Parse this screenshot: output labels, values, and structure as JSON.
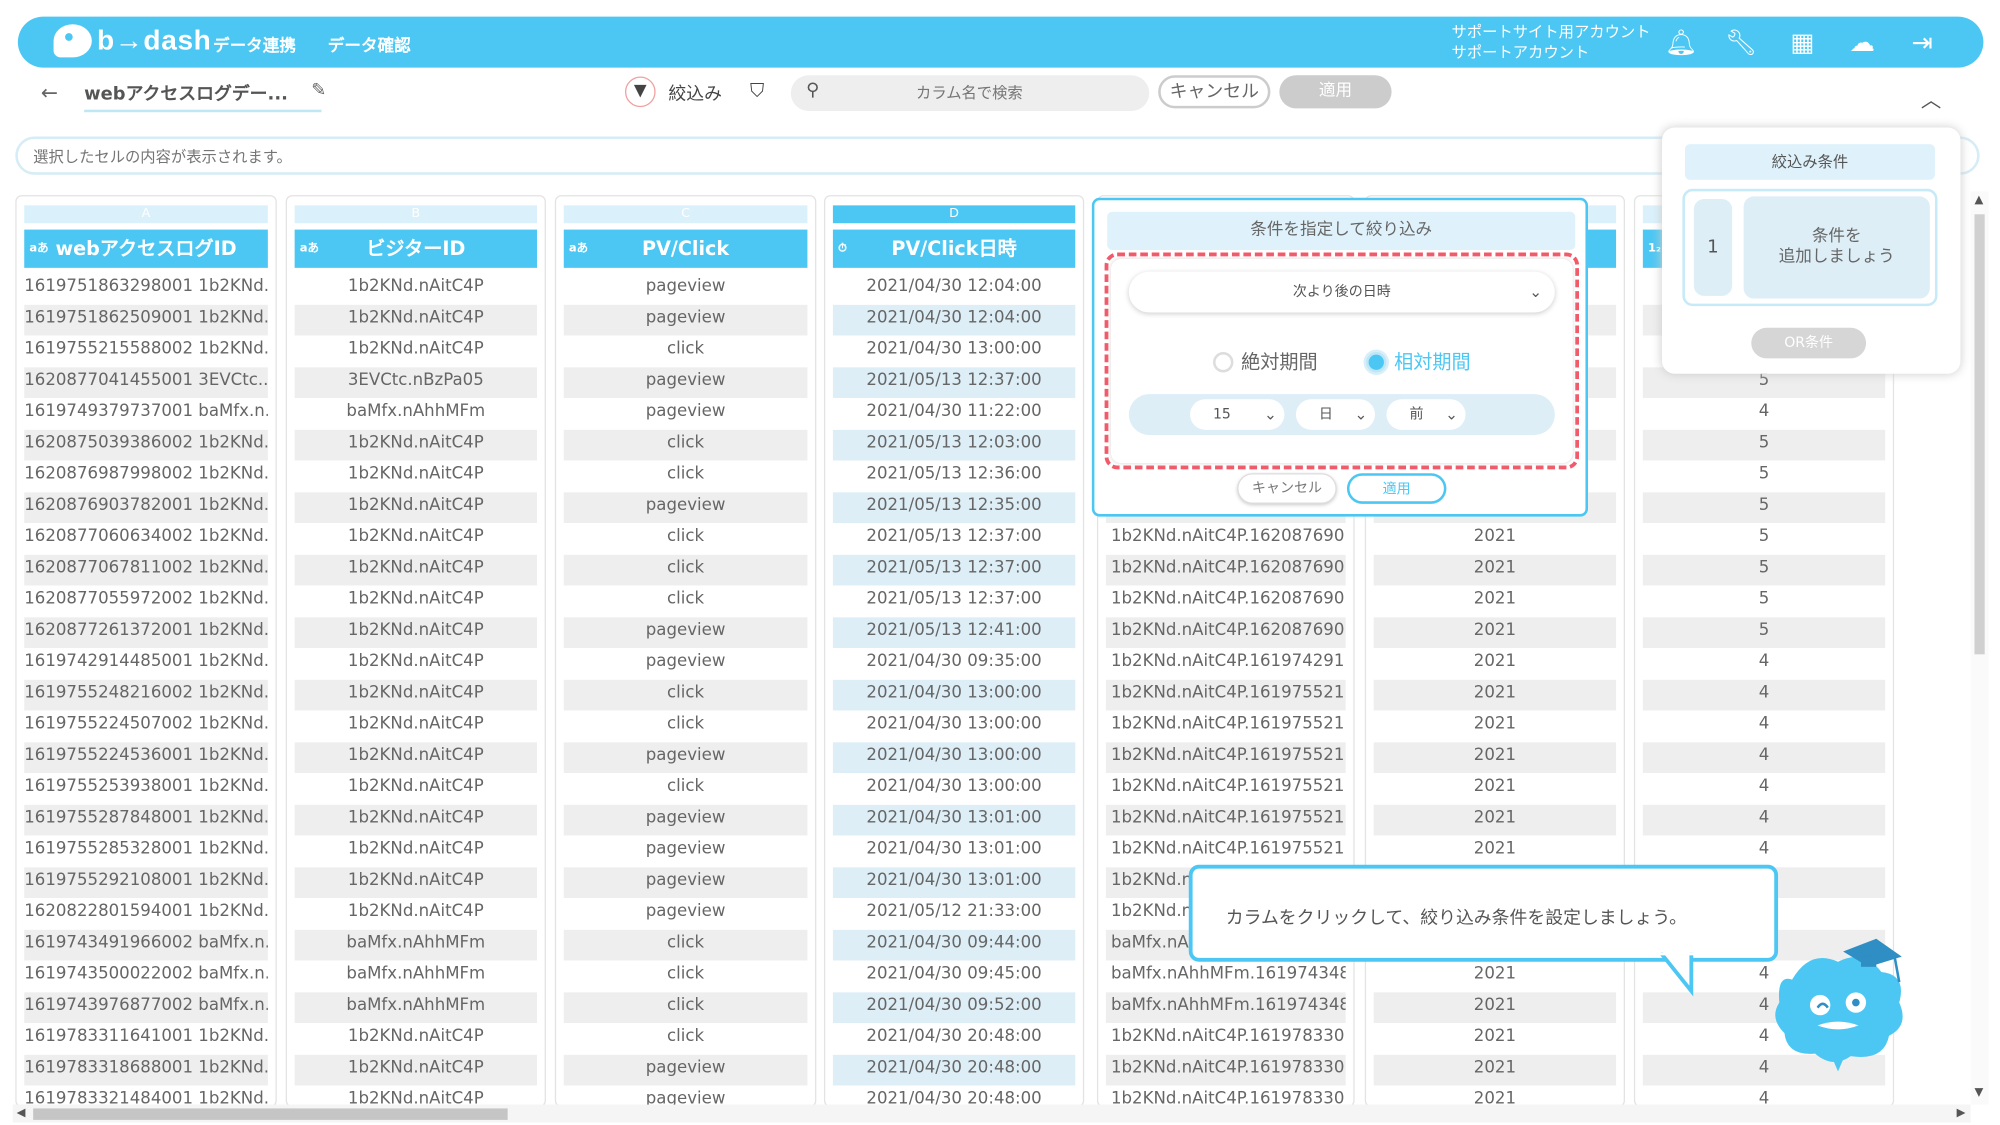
{
  "header": {
    "logo_text": "b→dash",
    "nav": [
      "データ連携",
      "データ確認"
    ],
    "account_line1": "サポートサイト用アカウント",
    "account_line2": "サポートアカウント",
    "icons": [
      "bell-icon",
      "wrench-icon",
      "grid-icon",
      "mascot-icon",
      "logout-icon"
    ]
  },
  "toolbar": {
    "back_icon": "←",
    "dataset_name": "webアクセスログデー...",
    "filter_label": "絞込み",
    "search_placeholder": "カラム名で検索",
    "cancel_label": "キャンセル",
    "apply_label": "適用"
  },
  "cell_preview": {
    "placeholder": "選択したセルの内容が表示されます。"
  },
  "columns": [
    {
      "letter": "A",
      "type_icon": "aあ",
      "name": "webアクセスログID"
    },
    {
      "letter": "B",
      "type_icon": "aあ",
      "name": "ビジターID"
    },
    {
      "letter": "C",
      "type_icon": "aあ",
      "name": "PV/Click"
    },
    {
      "letter": "D",
      "type_icon": "⏱",
      "name": "PV/Click日時"
    },
    {
      "letter": "",
      "type_icon": "",
      "name": ""
    },
    {
      "letter": "",
      "type_icon": "",
      "name": ""
    },
    {
      "letter": "",
      "type_icon": "1₂",
      "name": ""
    }
  ],
  "rows": [
    [
      "1619751863298001 1b2KNd...",
      "1b2KNd.nAitC4P",
      "pageview",
      "2021/04/30 12:04:00",
      "",
      "",
      ""
    ],
    [
      "1619751862509001 1b2KNd...",
      "1b2KNd.nAitC4P",
      "pageview",
      "2021/04/30 12:04:00",
      "",
      "",
      ""
    ],
    [
      "1619755215588002 1b2KNd...",
      "1b2KNd.nAitC4P",
      "click",
      "2021/04/30 13:00:00",
      "",
      "",
      ""
    ],
    [
      "1620877041455001 3EVCtc....",
      "3EVCtc.nBzPa05",
      "pageview",
      "2021/05/13 12:37:00",
      "",
      "",
      "5"
    ],
    [
      "1619749379737001 baMfx.n...",
      "baMfx.nAhhMFm",
      "pageview",
      "2021/04/30 11:22:00",
      "",
      "",
      "4"
    ],
    [
      "1620875039386002 1b2KNd...",
      "1b2KNd.nAitC4P",
      "click",
      "2021/05/13 12:03:00",
      "",
      "",
      "5"
    ],
    [
      "1620876987998002 1b2KNd...",
      "1b2KNd.nAitC4P",
      "click",
      "2021/05/13 12:36:00",
      "",
      "",
      "5"
    ],
    [
      "1620876903782001 1b2KNd...",
      "1b2KNd.nAitC4P",
      "pageview",
      "2021/05/13 12:35:00",
      "",
      "",
      "5"
    ],
    [
      "1620877060634002 1b2KNd...",
      "1b2KNd.nAitC4P",
      "click",
      "2021/05/13 12:37:00",
      "1b2KNd.nAitC4P.162087690...",
      "2021",
      "5"
    ],
    [
      "1620877067811002 1b2KNd...",
      "1b2KNd.nAitC4P",
      "click",
      "2021/05/13 12:37:00",
      "1b2KNd.nAitC4P.162087690...",
      "2021",
      "5"
    ],
    [
      "1620877055972002 1b2KNd...",
      "1b2KNd.nAitC4P",
      "click",
      "2021/05/13 12:37:00",
      "1b2KNd.nAitC4P.162087690...",
      "2021",
      "5"
    ],
    [
      "1620877261372001 1b2KNd...",
      "1b2KNd.nAitC4P",
      "pageview",
      "2021/05/13 12:41:00",
      "1b2KNd.nAitC4P.162087690...",
      "2021",
      "5"
    ],
    [
      "1619742914485001 1b2KNd...",
      "1b2KNd.nAitC4P",
      "pageview",
      "2021/04/30 09:35:00",
      "1b2KNd.nAitC4P.161974291...",
      "2021",
      "4"
    ],
    [
      "1619755248216002 1b2KNd...",
      "1b2KNd.nAitC4P",
      "click",
      "2021/04/30 13:00:00",
      "1b2KNd.nAitC4P.161975521...",
      "2021",
      "4"
    ],
    [
      "1619755224507002 1b2KNd...",
      "1b2KNd.nAitC4P",
      "click",
      "2021/04/30 13:00:00",
      "1b2KNd.nAitC4P.161975521...",
      "2021",
      "4"
    ],
    [
      "1619755224536001 1b2KNd...",
      "1b2KNd.nAitC4P",
      "pageview",
      "2021/04/30 13:00:00",
      "1b2KNd.nAitC4P.161975521...",
      "2021",
      "4"
    ],
    [
      "1619755253938001 1b2KNd...",
      "1b2KNd.nAitC4P",
      "click",
      "2021/04/30 13:00:00",
      "1b2KNd.nAitC4P.161975521...",
      "2021",
      "4"
    ],
    [
      "1619755287848001 1b2KNd...",
      "1b2KNd.nAitC4P",
      "pageview",
      "2021/04/30 13:01:00",
      "1b2KNd.nAitC4P.161975521...",
      "2021",
      "4"
    ],
    [
      "1619755285328001 1b2KNd...",
      "1b2KNd.nAitC4P",
      "pageview",
      "2021/04/30 13:01:00",
      "1b2KNd.nAitC4P.161975521...",
      "2021",
      "4"
    ],
    [
      "1619755292108001 1b2KNd...",
      "1b2KNd.nAitC4P",
      "pageview",
      "2021/04/30 13:01:00",
      "1b2KNd.n",
      "",
      ""
    ],
    [
      "1620822801594001 1b2KNd...",
      "1b2KNd.nAitC4P",
      "pageview",
      "2021/05/12 21:33:00",
      "1b2KNd.n",
      "",
      ""
    ],
    [
      "1619743491966002 baMfx.n...",
      "baMfx.nAhhMFm",
      "click",
      "2021/04/30 09:44:00",
      "baMfx.nAh",
      "",
      ""
    ],
    [
      "1619743500022002 baMfx.n...",
      "baMfx.nAhhMFm",
      "click",
      "2021/04/30 09:45:00",
      "baMfx.nAhhMFm.161974348...",
      "2021",
      "4"
    ],
    [
      "1619743976877002 baMfx.n...",
      "baMfx.nAhhMFm",
      "click",
      "2021/04/30 09:52:00",
      "baMfx.nAhhMFm.161974348...",
      "2021",
      "4"
    ],
    [
      "1619783311641001 1b2KNd...",
      "1b2KNd.nAitC4P",
      "click",
      "2021/04/30 20:48:00",
      "1b2KNd.nAitC4P.161978330...",
      "2021",
      "4"
    ],
    [
      "1619783318688001 1b2KNd...",
      "1b2KNd.nAitC4P",
      "pageview",
      "2021/04/30 20:48:00",
      "1b2KNd.nAitC4P.161978330...",
      "2021",
      "4"
    ],
    [
      "1619783321484001 1b2KNd...",
      "1b2KNd.nAitC4P",
      "pageview",
      "2021/04/30 20:48:00",
      "1b2KNd.nAitC4P.161978330...",
      "2021",
      "4"
    ]
  ],
  "filter_popup": {
    "title": "条件を指定して絞り込み",
    "operator": "次より後の日時",
    "radio_absolute": "絶対期間",
    "radio_relative": "相対期間",
    "selected_radio": "相対期間",
    "amount": "15",
    "unit": "日",
    "direction": "前",
    "cancel_label": "キャンセル",
    "apply_label": "適用"
  },
  "conditions_panel": {
    "title": "絞込み条件",
    "index": "1",
    "add_line1": "条件を",
    "add_line2": "追加しましょう",
    "or_label": "OR条件"
  },
  "tooltip": {
    "text": "カラムをクリックして、絞り込み条件を設定しましょう。"
  },
  "colors": {
    "accent": "#4cc7f3",
    "highlight": "#f05a6a"
  }
}
